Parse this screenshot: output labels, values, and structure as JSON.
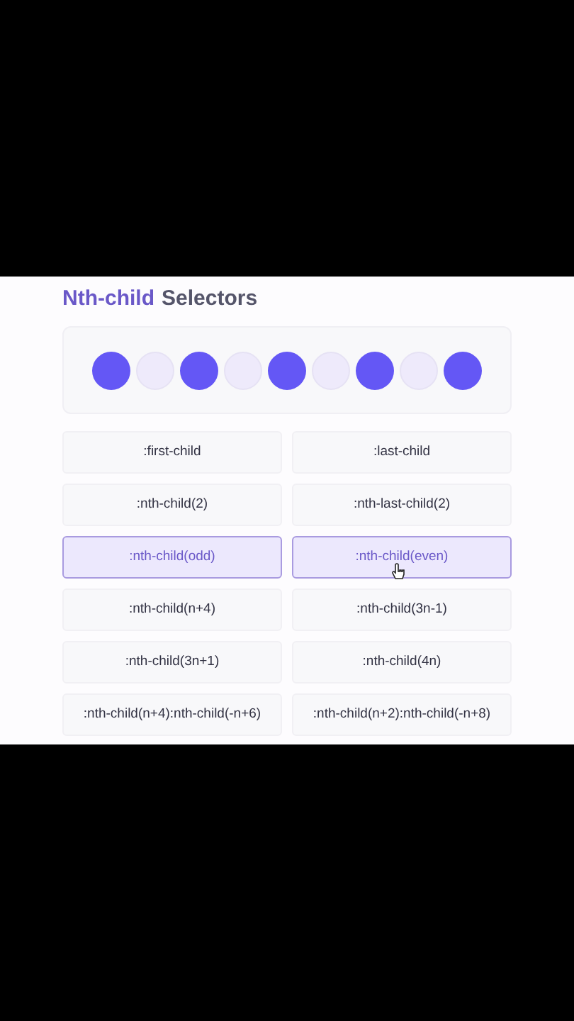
{
  "title": {
    "accent": "Nth-child",
    "rest": "Selectors"
  },
  "circles": [
    {
      "highlighted": true
    },
    {
      "highlighted": false
    },
    {
      "highlighted": true
    },
    {
      "highlighted": false
    },
    {
      "highlighted": true
    },
    {
      "highlighted": false
    },
    {
      "highlighted": true
    },
    {
      "highlighted": false
    },
    {
      "highlighted": true
    }
  ],
  "selectors": [
    {
      "label": ":first-child",
      "selected": false
    },
    {
      "label": ":last-child",
      "selected": false
    },
    {
      "label": ":nth-child(2)",
      "selected": false
    },
    {
      "label": ":nth-last-child(2)",
      "selected": false
    },
    {
      "label": ":nth-child(odd)",
      "selected": true
    },
    {
      "label": ":nth-child(even)",
      "selected": true
    },
    {
      "label": ":nth-child(n+4)",
      "selected": false
    },
    {
      "label": ":nth-child(3n-1)",
      "selected": false
    },
    {
      "label": ":nth-child(3n+1)",
      "selected": false
    },
    {
      "label": ":nth-child(4n)",
      "selected": false
    },
    {
      "label": ":nth-child(n+4):nth-child(-n+6)",
      "selected": false
    },
    {
      "label": ":nth-child(n+2):nth-child(-n+8)",
      "selected": false
    }
  ]
}
